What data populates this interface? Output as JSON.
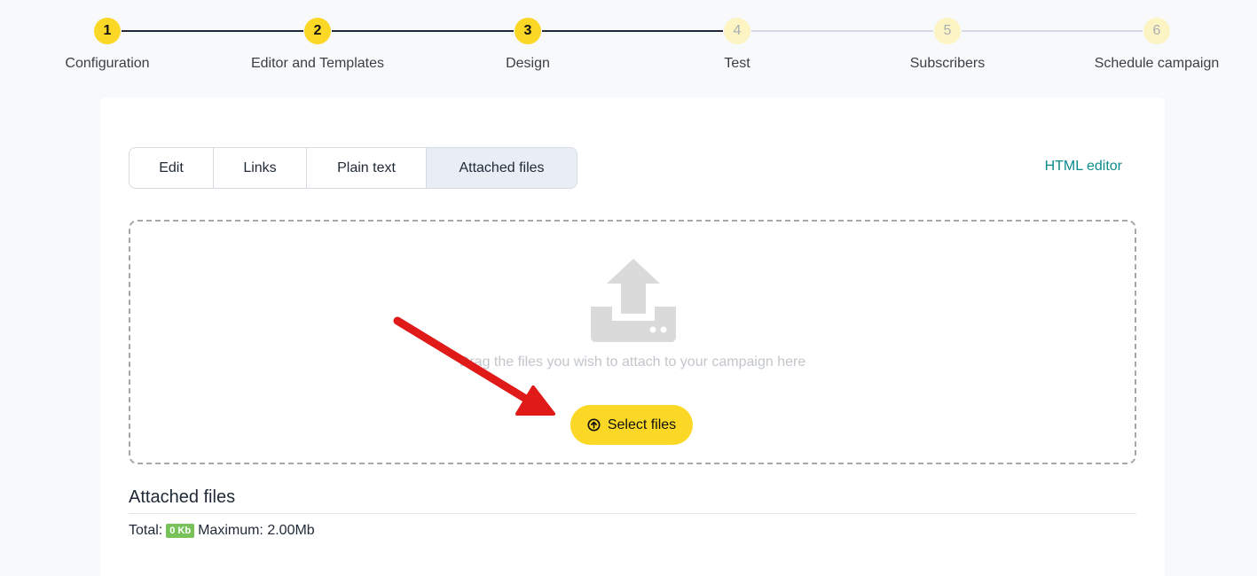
{
  "stepper": {
    "steps": [
      {
        "number": "1",
        "label": "Configuration",
        "state": "done"
      },
      {
        "number": "2",
        "label": "Editor and Templates",
        "state": "done"
      },
      {
        "number": "3",
        "label": "Design",
        "state": "done"
      },
      {
        "number": "4",
        "label": "Test",
        "state": "todo"
      },
      {
        "number": "5",
        "label": "Subscribers",
        "state": "todo"
      },
      {
        "number": "6",
        "label": "Schedule campaign",
        "state": "todo"
      }
    ]
  },
  "tabs": {
    "edit": "Edit",
    "links": "Links",
    "plain_text": "Plain text",
    "attached_files": "Attached files",
    "active": "Attached files"
  },
  "html_editor_link": "HTML editor",
  "dropzone": {
    "icon": "upload-tray-icon",
    "text": "Drag the files you wish to attach to your campaign here",
    "button_label": "Select files",
    "button_icon": "arrow-up-circle-icon"
  },
  "attached": {
    "title": "Attached files",
    "total_label": "Total:",
    "total_value": "0 Kb",
    "maximum_text": "Maximum: 2.00Mb"
  },
  "annotation": {
    "icon": "red-arrow-icon"
  },
  "colors": {
    "accent_yellow": "#fcd826",
    "link_teal": "#0d8a8a",
    "badge_green": "#78c25a",
    "arrow_red": "#e01919"
  }
}
